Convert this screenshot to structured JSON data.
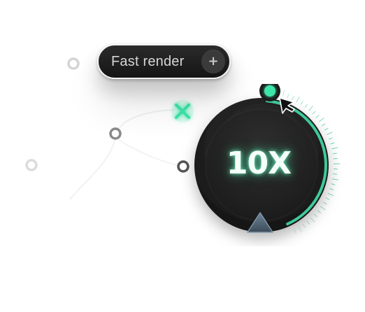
{
  "pill_button": {
    "label": "Fast render",
    "action_icon": "plus-icon",
    "action_glyph": "+"
  },
  "dial": {
    "value_label": "10X",
    "level": 0.42,
    "accent_color": "#3ec99a",
    "handle_color": "#3ee6a8",
    "pointer_icon": "triangle-pointer-icon",
    "cursor_icon": "mouse-cursor-icon"
  },
  "decorations": {
    "cross_marker_icon": "x-marker-icon",
    "connector_dot_icon": "ring-dot-icon",
    "accent_color": "#3ee6a8"
  }
}
